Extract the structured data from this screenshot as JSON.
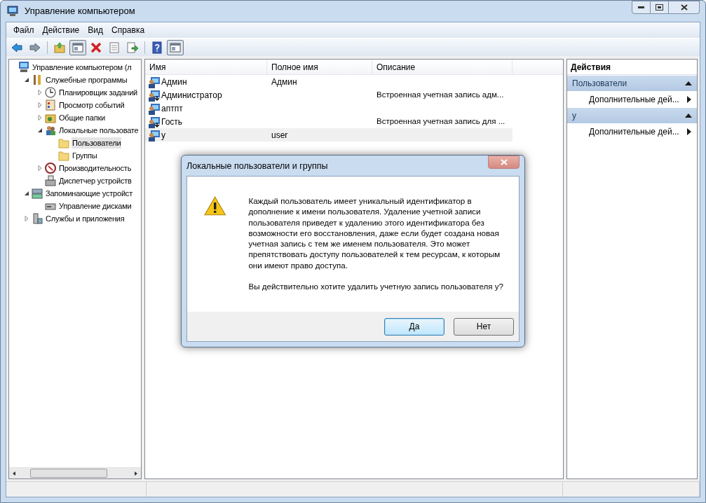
{
  "window": {
    "title": "Управление компьютером"
  },
  "menu": [
    "Файл",
    "Действие",
    "Вид",
    "Справка"
  ],
  "toolbar": [
    {
      "kind": "back",
      "pressed": false
    },
    {
      "kind": "forward",
      "pressed": false
    },
    {
      "kind": "sep"
    },
    {
      "kind": "up",
      "pressed": false
    },
    {
      "kind": "panel",
      "pressed": true
    },
    {
      "kind": "delete",
      "pressed": false
    },
    {
      "kind": "props",
      "pressed": false
    },
    {
      "kind": "export",
      "pressed": false
    },
    {
      "kind": "sep"
    },
    {
      "kind": "help",
      "pressed": false
    },
    {
      "kind": "panel",
      "pressed": true
    }
  ],
  "tree": [
    {
      "label": "Управление компьютером (л",
      "kind": "computer",
      "expandable": false,
      "selected": false,
      "children": [
        {
          "label": "Служебные программы",
          "kind": "tools",
          "expandable": true,
          "expanded": true,
          "selected": false,
          "children": [
            {
              "label": "Планировщик заданий",
              "kind": "clock",
              "expandable": true,
              "expanded": false,
              "selected": false
            },
            {
              "label": "Просмотр событий",
              "kind": "log",
              "expandable": true,
              "expanded": false,
              "selected": false
            },
            {
              "label": "Общие папки",
              "kind": "share",
              "expandable": true,
              "expanded": false,
              "selected": false
            },
            {
              "label": "Локальные пользовате",
              "kind": "users",
              "expandable": true,
              "expanded": true,
              "selected": false,
              "children": [
                {
                  "label": "Пользователи",
                  "kind": "folder",
                  "expandable": false,
                  "selected": true
                },
                {
                  "label": "Группы",
                  "kind": "folder",
                  "expandable": false,
                  "selected": false
                }
              ]
            },
            {
              "label": "Производительность",
              "kind": "perf",
              "expandable": true,
              "expanded": false,
              "selected": false
            },
            {
              "label": "Диспетчер устройств",
              "kind": "device",
              "expandable": false,
              "selected": false
            }
          ]
        },
        {
          "label": "Запоминающие устройст",
          "kind": "storage",
          "expandable": true,
          "expanded": true,
          "selected": false,
          "children": [
            {
              "label": "Управление дисками",
              "kind": "disk",
              "expandable": false,
              "selected": false
            }
          ]
        },
        {
          "label": "Службы и приложения",
          "kind": "services",
          "expandable": true,
          "expanded": false,
          "selected": false
        }
      ]
    }
  ],
  "table": {
    "columns": [
      "Имя",
      "Полное имя",
      "Описание"
    ],
    "rows": [
      {
        "kind": "user",
        "name": "Админ",
        "full_name": "Админ",
        "selected": false
      },
      {
        "kind": "builtin",
        "name": "Администратор",
        "description": "Встроенная учетная запись адм...",
        "selected": false
      },
      {
        "kind": "user",
        "name": "аптпт",
        "selected": false
      },
      {
        "kind": "builtin",
        "name": "Гость",
        "description": "Встроенная учетная запись для ...",
        "selected": false
      },
      {
        "kind": "user",
        "name": "y",
        "full_name": "user",
        "selected": true
      }
    ]
  },
  "actions": {
    "title": "Действия",
    "sections": [
      {
        "title": "Пользователи",
        "items": [
          "Дополнительные дей..."
        ]
      },
      {
        "title": "y",
        "items": [
          "Дополнительные дей..."
        ]
      }
    ]
  },
  "dialog": {
    "title": "Локальные пользователи и группы",
    "message": "Каждый пользователь имеет уникальный идентификатор в дополнение к имени пользователя. Удаление учетной записи пользователя приведет к удалению этого идентификатора без возможности его восстановления, даже если будет создана новая учетная запись с тем же именем пользователя. Это может препятствовать доступу пользователей к тем ресурсам, к которым они имеют право доступа.",
    "question": "Вы действительно хотите удалить учетную запись пользователя y?",
    "buttons": [
      {
        "label": "Да",
        "default": true
      },
      {
        "label": "Нет",
        "default": false
      }
    ]
  }
}
